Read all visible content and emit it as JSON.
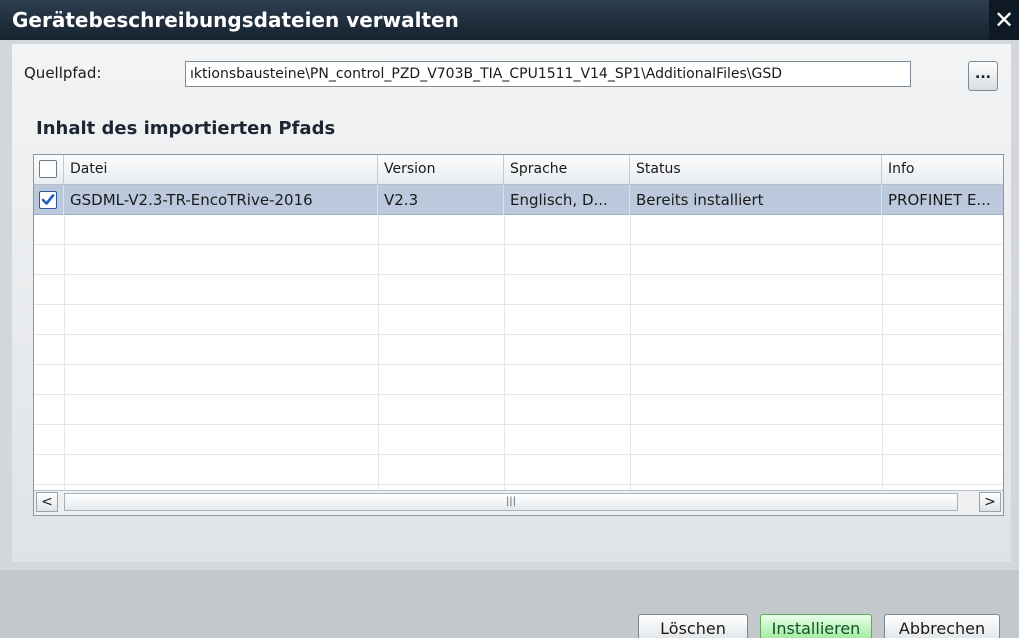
{
  "dialog": {
    "title": "Gerätebeschreibungsdateien verwalten",
    "close_glyph": "✕"
  },
  "source": {
    "label": "Quellpfad:",
    "path": "ıktionsbausteine\\PN_control_PZD_V703B_TIA_CPU1511_V14_SP1\\AdditionalFiles\\GSD",
    "browse_label": "..."
  },
  "section": {
    "title": "Inhalt des importierten Pfads"
  },
  "table": {
    "columns": [
      "Datei",
      "Version",
      "Sprache",
      "Status",
      "Info"
    ],
    "rows": [
      {
        "checked": true,
        "datei": "GSDML-V2.3-TR-EncoTRive-2016",
        "version": "V2.3",
        "sprache": "Englisch, D...",
        "status": "Bereits installiert",
        "info": "PROFINET E..."
      }
    ],
    "scroll_left": "<",
    "scroll_right": ">",
    "scroll_grip": "|||"
  },
  "buttons": {
    "delete": "Löschen",
    "install": "Installieren",
    "cancel": "Abbrechen"
  },
  "colors": {
    "titlebar": "#1e2b39",
    "selected_row": "#bcc9dc",
    "install_button": "#98e695"
  }
}
